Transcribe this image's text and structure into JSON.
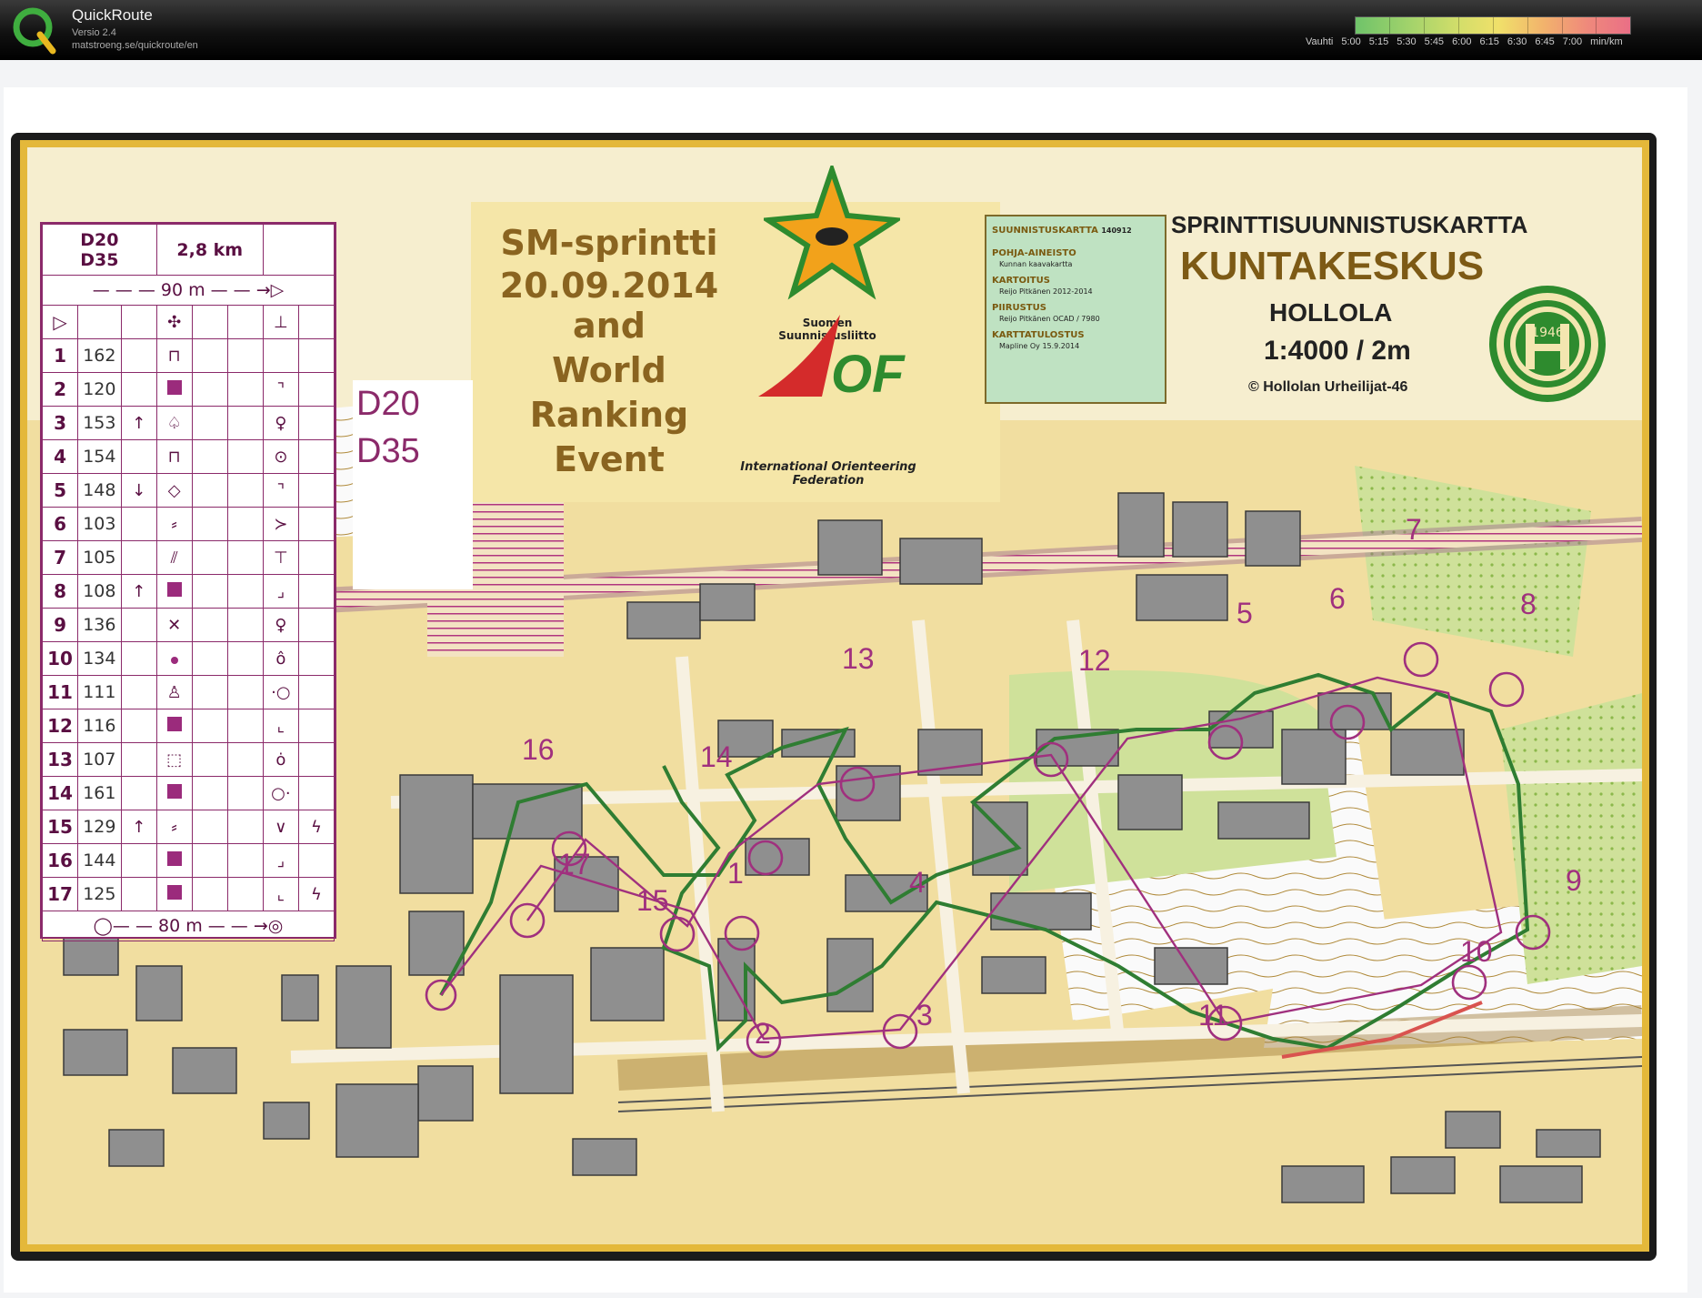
{
  "app": {
    "name": "QuickRoute",
    "version": "Versio 2.4",
    "url": "matstroeng.se/quickroute/en"
  },
  "pace_scale": {
    "label": "Vauhti",
    "ticks": [
      "5:00",
      "5:15",
      "5:30",
      "5:45",
      "6:00",
      "6:15",
      "6:30",
      "6:45",
      "7:00"
    ],
    "unit": "min/km"
  },
  "course": {
    "classes": [
      "D20",
      "D35"
    ],
    "length": "2,8 km",
    "start_distance": "90 m",
    "finish_distance": "80 m",
    "controls": [
      {
        "n": "1",
        "code": "162"
      },
      {
        "n": "2",
        "code": "120"
      },
      {
        "n": "3",
        "code": "153"
      },
      {
        "n": "4",
        "code": "154"
      },
      {
        "n": "5",
        "code": "148"
      },
      {
        "n": "6",
        "code": "103"
      },
      {
        "n": "7",
        "code": "105"
      },
      {
        "n": "8",
        "code": "108"
      },
      {
        "n": "9",
        "code": "136"
      },
      {
        "n": "10",
        "code": "134"
      },
      {
        "n": "11",
        "code": "111"
      },
      {
        "n": "12",
        "code": "116"
      },
      {
        "n": "13",
        "code": "107"
      },
      {
        "n": "14",
        "code": "161"
      },
      {
        "n": "15",
        "code": "129"
      },
      {
        "n": "16",
        "code": "144"
      },
      {
        "n": "17",
        "code": "125"
      }
    ]
  },
  "event": {
    "title": "SM-sprintti",
    "date": "20.09.2014",
    "name": [
      "and",
      "World",
      "Ranking",
      "Event"
    ],
    "federation": "Suomen Suunnistusliitto",
    "iof": "International Orienteering Federation"
  },
  "map_info": {
    "rows": [
      {
        "h": "SUUNNISTUSKARTTA",
        "v": "140912"
      },
      {
        "h": "POHJA-AINEISTO",
        "v": "Kunnan kaavakartta"
      },
      {
        "h": "KARTOITUS",
        "v": "Reijo Pitkänen 2012-2014"
      },
      {
        "h": "PIIRUSTUS",
        "v": "Reijo Pitkänen OCAD / 7980"
      },
      {
        "h": "KARTTATULOSTUS",
        "v": "Mapline Oy 15.9.2014"
      }
    ],
    "title": "SPRINTTISUUNNISTUSKARTTA",
    "name": "KUNTAKESKUS",
    "place": "HOLLOLA",
    "scale": "1:4000 / 2m",
    "copyright": "© Hollolan Urheilijat-46",
    "club_year": "1946"
  },
  "colors": {
    "course_purple": "#a0307e",
    "route_green": "#2f7d32",
    "route_red": "#d9534f",
    "map_yellow": "#f2d98a",
    "building_gray": "#8c8c8c",
    "vegetation_green": "#9bc45a"
  }
}
